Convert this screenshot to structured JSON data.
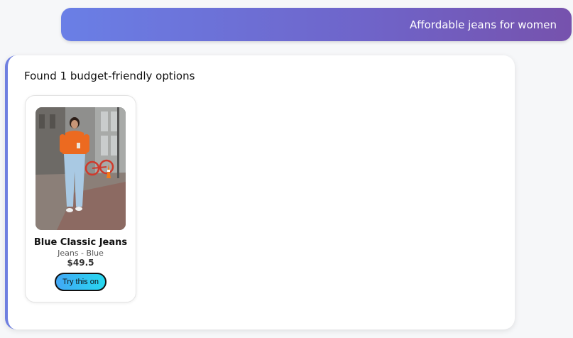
{
  "user_message": {
    "text": "Affordable jeans for women"
  },
  "assistant_message": {
    "heading": "Found 1 budget-friendly options",
    "products": [
      {
        "name": "Blue Classic Jeans",
        "meta": "Jeans - Blue",
        "price": "$49.5",
        "button_label": "Try this on",
        "image_alt": "Woman in orange sweater and light blue jeans on a city street"
      }
    ]
  },
  "colors": {
    "user_bubble_start": "#6a7fe6",
    "user_bubble_end": "#7652ad",
    "panel_accent": "#6f7fe0",
    "button_start": "#42a8f6",
    "button_end": "#27d8ef"
  }
}
